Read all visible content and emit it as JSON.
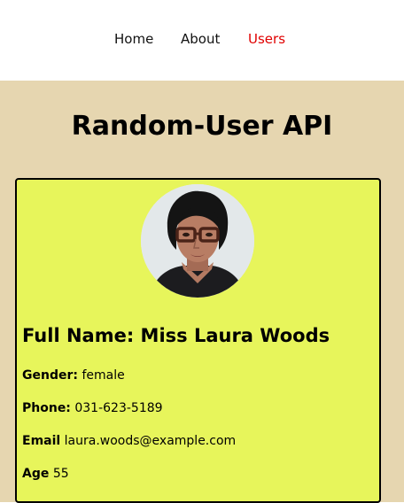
{
  "nav": {
    "items": [
      {
        "label": "Home",
        "active": false
      },
      {
        "label": "About",
        "active": false
      },
      {
        "label": "Users",
        "active": true
      }
    ],
    "active_color": "#e00000"
  },
  "page": {
    "title": "Random-User API",
    "background_color": "#e6d6b0"
  },
  "user_card": {
    "background_color": "#e7f55b",
    "avatar_icon": "user-portrait-photo",
    "full_name_label": "Full Name:",
    "full_name_value": "Miss Laura Woods",
    "fields": [
      {
        "label": "Gender:",
        "value": "female"
      },
      {
        "label": "Phone:",
        "value": "031-623-5189"
      },
      {
        "label": "Email",
        "value": "laura.woods@example.com"
      },
      {
        "label": "Age",
        "value": "55"
      }
    ]
  }
}
